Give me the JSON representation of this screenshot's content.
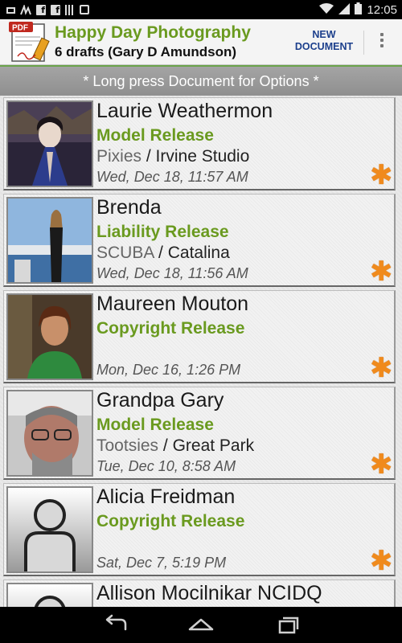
{
  "status_bar": {
    "time": "12:05",
    "left_icons": [
      "mail-icon",
      "signature-icon",
      "facebook-icon",
      "facebook-icon",
      "barcode-icon",
      "shopping-bag-icon"
    ],
    "right_icons": [
      "wifi-icon",
      "signal-icon",
      "battery-icon"
    ]
  },
  "action_bar": {
    "title": "Happy Day Photography",
    "subtitle": "6 drafts  (Gary D Amundson)",
    "new_document_line1": "NEW",
    "new_document_line2": "DOCUMENT",
    "logo_text": "PDF",
    "brand_color": "#6a9a1f"
  },
  "hint": "* Long press Document for Options *",
  "documents": [
    {
      "name": "Laurie Weathermon",
      "type": "Model Release",
      "location_a": "Pixies",
      "location_sep": " / ",
      "location_b": "Irvine Studio",
      "date": "Wed, Dec 18, 11:57 AM",
      "thumb": "photo-woman-dark"
    },
    {
      "name": "Brenda",
      "type": "Liability Release",
      "location_a": "SCUBA",
      "location_sep": " / ",
      "location_b": "Catalina",
      "date": "Wed, Dec 18, 11:56 AM",
      "thumb": "photo-woman-boat"
    },
    {
      "name": "Maureen Mouton",
      "type": "Copyright Release",
      "location_a": "",
      "location_sep": "",
      "location_b": "",
      "date": "Mon, Dec 16, 1:26 PM",
      "thumb": "photo-woman-green"
    },
    {
      "name": "Grandpa Gary",
      "type": "Model Release",
      "location_a": "Tootsies",
      "location_sep": " / ",
      "location_b": "Great Park",
      "date": "Tue, Dec 10, 8:58 AM",
      "thumb": "photo-man-glasses"
    },
    {
      "name": "Alicia Freidman",
      "type": "Copyright Release",
      "location_a": "",
      "location_sep": "",
      "location_b": "",
      "date": "Sat, Dec 7, 5:19 PM",
      "thumb": "placeholder-person"
    },
    {
      "name": "Allison Mocilnikar NCIDQ",
      "type": "",
      "location_a": "",
      "location_sep": "",
      "location_b": "",
      "date": "",
      "thumb": "placeholder-person"
    }
  ],
  "nav_bar": {
    "icons": [
      "back-icon",
      "home-icon",
      "recent-apps-icon"
    ]
  }
}
